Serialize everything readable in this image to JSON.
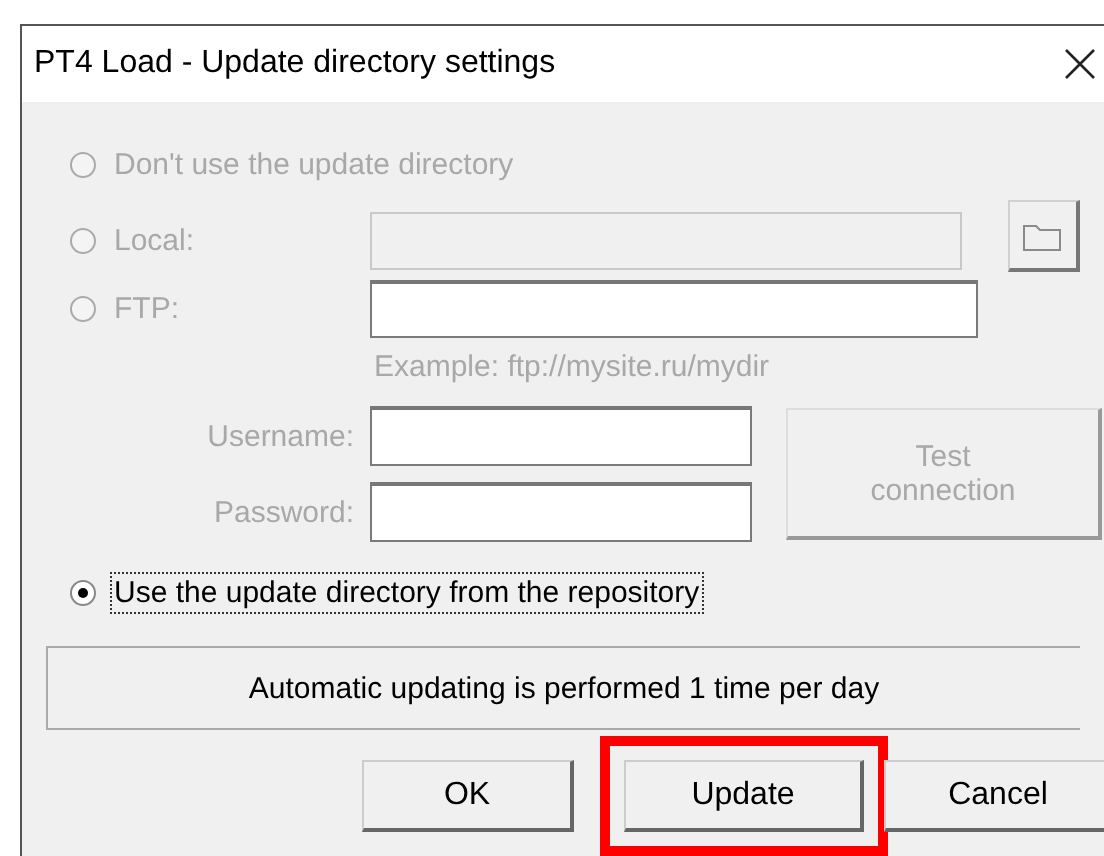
{
  "window": {
    "title": "PT4 Load - Update directory settings"
  },
  "options": [
    {
      "kind": "plain",
      "label": "Don't use the update directory",
      "selected": false,
      "disabled": true,
      "focused": false
    },
    {
      "kind": "local",
      "label": "Local:",
      "selected": false,
      "disabled": true,
      "focused": false,
      "field_disabled": true
    },
    {
      "kind": "ftp",
      "label": "FTP:",
      "selected": false,
      "disabled": true,
      "focused": false,
      "field_disabled": false,
      "example": "Example: ftp://mysite.ru/mydir",
      "username_label": "Username:",
      "password_label": "Password:",
      "test_button": {
        "label": "Test connection",
        "disabled": true
      }
    },
    {
      "kind": "plain",
      "label": "Use the update directory from the repository",
      "selected": true,
      "disabled": false,
      "focused": true
    }
  ],
  "info": "Automatic updating is performed 1 time per day",
  "buttons": [
    {
      "label": "OK",
      "highlighted": false
    },
    {
      "label": "Update",
      "highlighted": true
    },
    {
      "label": "Cancel",
      "highlighted": false
    }
  ]
}
